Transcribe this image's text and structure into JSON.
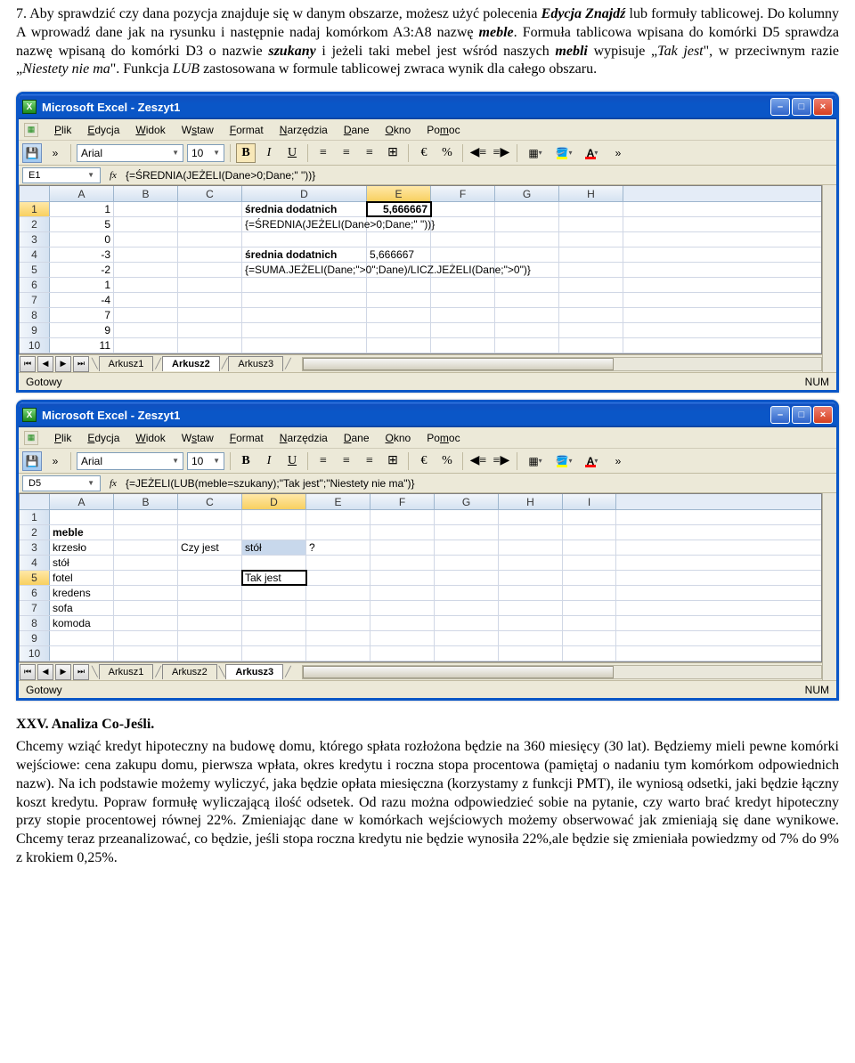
{
  "para1": {
    "prefix": "7. Aby sprawdzić czy dana pozycja znajduje się w danym obszarze, możesz użyć polecenia ",
    "em1": "Edycja Znajdź",
    "mid1": " lub formuły tablicowej. Do kolumny A wprowadź dane jak na rysunku i następnie nadaj komórkom A3:A8 nazwę ",
    "em2": "meble",
    "mid2": ". Formuła tablicowa wpisana do komórki D5 sprawdza nazwę wpisaną do komórki D3 o nazwie ",
    "em3": "szukany",
    "mid3": " i jeżeli taki mebel jest wśród naszych ",
    "em4": "mebli",
    "mid4": " wypisuje „",
    "em5": "Tak jest",
    "mid5": "\", w przeciwnym razie „",
    "em6": "Niestety nie ma",
    "mid6": "\". Funkcja ",
    "em7": "LUB",
    "suffix": " zastosowana w formule tablicowej zwraca wynik dla całego obszaru."
  },
  "excel1": {
    "title": "Microsoft Excel - Zeszyt1",
    "menu": [
      "Plik",
      "Edycja",
      "Widok",
      "Wstaw",
      "Format",
      "Narzędzia",
      "Dane",
      "Okno",
      "Pomoc"
    ],
    "font": "Arial",
    "size": "10",
    "namebox": "E1",
    "formula": "{=ŚREDNIA(JEŻELI(Dane>0;Dane;\" \"))}",
    "cols": [
      "A",
      "B",
      "C",
      "D",
      "E",
      "F",
      "G",
      "H"
    ],
    "rows": [
      {
        "n": "1",
        "A": "1",
        "D": "średnia dodatnich",
        "E": "5,666667"
      },
      {
        "n": "2",
        "A": "5",
        "D": "{=ŚREDNIA(JEŻELI(Dane>0;Dane;\" \"))}"
      },
      {
        "n": "3",
        "A": "0"
      },
      {
        "n": "4",
        "A": "-3",
        "D": "średnia dodatnich",
        "E": "5,666667"
      },
      {
        "n": "5",
        "A": "-2",
        "D": "{=SUMA.JEŻELI(Dane;\">0\";Dane)/LICZ.JEŻELI(Dane;\">0\")}"
      },
      {
        "n": "6",
        "A": "1"
      },
      {
        "n": "7",
        "A": "-4"
      },
      {
        "n": "8",
        "A": "7"
      },
      {
        "n": "9",
        "A": "9"
      },
      {
        "n": "10",
        "A": "11"
      }
    ],
    "tabs": [
      "Arkusz1",
      "Arkusz2",
      "Arkusz3"
    ],
    "activeTab": "Arkusz2",
    "status": "Gotowy",
    "num": "NUM"
  },
  "excel2": {
    "title": "Microsoft Excel - Zeszyt1",
    "menu": [
      "Plik",
      "Edycja",
      "Widok",
      "Wstaw",
      "Format",
      "Narzędzia",
      "Dane",
      "Okno",
      "Pomoc"
    ],
    "font": "Arial",
    "size": "10",
    "namebox": "D5",
    "formula": "{=JEŻELI(LUB(meble=szukany);\"Tak jest\";\"Niestety nie ma\")}",
    "cols": [
      "A",
      "B",
      "C",
      "D",
      "E",
      "F",
      "G",
      "H",
      "I"
    ],
    "rows": [
      {
        "n": "1"
      },
      {
        "n": "2",
        "A": "meble"
      },
      {
        "n": "3",
        "A": "krzesło",
        "C": "Czy jest",
        "D": "stół",
        "E": "?"
      },
      {
        "n": "4",
        "A": "stół"
      },
      {
        "n": "5",
        "A": "fotel",
        "D": "Tak jest"
      },
      {
        "n": "6",
        "A": "kredens"
      },
      {
        "n": "7",
        "A": "sofa"
      },
      {
        "n": "8",
        "A": "komoda"
      },
      {
        "n": "9"
      },
      {
        "n": "10"
      }
    ],
    "tabs": [
      "Arkusz1",
      "Arkusz2",
      "Arkusz3"
    ],
    "activeTab": "Arkusz3",
    "status": "Gotowy",
    "num": "NUM"
  },
  "heading2": "XXV. Analiza Co-Jeśli.",
  "para2": "Chcemy wziąć kredyt hipoteczny na budowę domu, którego spłata rozłożona będzie na 360 miesięcy (30 lat). Będziemy mieli pewne komórki wejściowe: cena zakupu domu, pierwsza wpłata, okres kredytu i roczna stopa procentowa (pamiętaj o nadaniu tym komórkom odpowiednich nazw). Na ich podstawie możemy wyliczyć, jaka będzie opłata miesięczna (korzystamy z funkcji PMT), ile wyniosą odsetki, jaki będzie łączny koszt kredytu. Popraw formułę wyliczającą ilość odsetek. Od razu można odpowiedzieć sobie na pytanie, czy warto brać kredyt hipoteczny przy stopie procentowej równej 22%. Zmieniając dane w komórkach wejściowych możemy obserwować jak zmieniają się dane wynikowe. Chcemy teraz przeanalizować, co będzie, jeśli stopa roczna kredytu nie będzie wynosiła 22%,ale będzie się zmieniała powiedzmy od 7% do 9% z krokiem 0,25%."
}
